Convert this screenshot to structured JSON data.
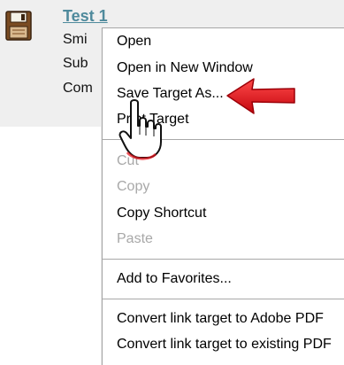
{
  "result": {
    "title": "Test 1",
    "lines": [
      "Smi",
      "Sub",
      "Com"
    ],
    "icon": "floppy-disk-icon"
  },
  "context_menu": {
    "items": [
      {
        "label": "Open",
        "enabled": true
      },
      {
        "label": "Open in New Window",
        "enabled": true
      },
      {
        "label": "Save Target As...",
        "enabled": true
      },
      {
        "label": "Print Target",
        "enabled": true
      },
      {
        "label": "Cut",
        "enabled": false
      },
      {
        "label": "Copy",
        "enabled": false
      },
      {
        "label": "Copy Shortcut",
        "enabled": true
      },
      {
        "label": "Paste",
        "enabled": false
      },
      {
        "label": "Add to Favorites...",
        "enabled": true
      },
      {
        "label": "Convert link target to Adobe PDF",
        "enabled": true
      },
      {
        "label": "Convert link target to existing PDF",
        "enabled": true
      }
    ]
  },
  "annotation": {
    "arrow_color": "#e8121b",
    "cursor": "hand-pointer-icon"
  },
  "colors": {
    "link": "#4f8a9c",
    "disabled_text": "#a8a8a8",
    "panel_bg": "#efefef"
  }
}
